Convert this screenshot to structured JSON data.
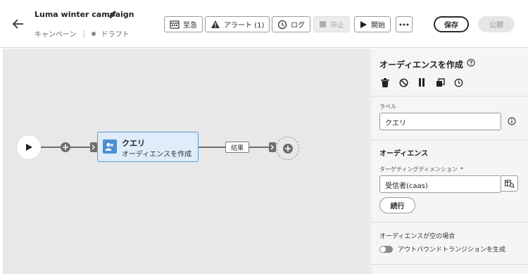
{
  "header": {
    "title": "Luma winter campaign",
    "breadcrumb_type": "キャンペーン",
    "status": "ドラフト",
    "buttons": {
      "urgent": "至急",
      "alert": "アラート (1)",
      "log": "ログ",
      "stop": "停止",
      "start": "開始",
      "save": "保存",
      "publish": "公開"
    }
  },
  "canvas": {
    "node": {
      "title": "クエリ",
      "subtitle": "オーディエンスを作成"
    },
    "result_label": "結果"
  },
  "panel": {
    "title": "オーディエンスを作成",
    "label_caption": "ラベル",
    "label_value": "クエリ",
    "audience_title": "オーディエンス",
    "targeting_caption": "ターゲティングディメンション",
    "required_mark": "*",
    "targeting_value": "受信者(caas)",
    "continue_label": "続行",
    "empty_audience_title": "オーディエンスが空の場合",
    "outbound_toggle_label": "アウトバウンドトランジションを生成"
  },
  "colors": {
    "node_fill": "#deedf9",
    "node_border": "#5a9bd6",
    "canvas_bg": "#e8e8e8"
  }
}
